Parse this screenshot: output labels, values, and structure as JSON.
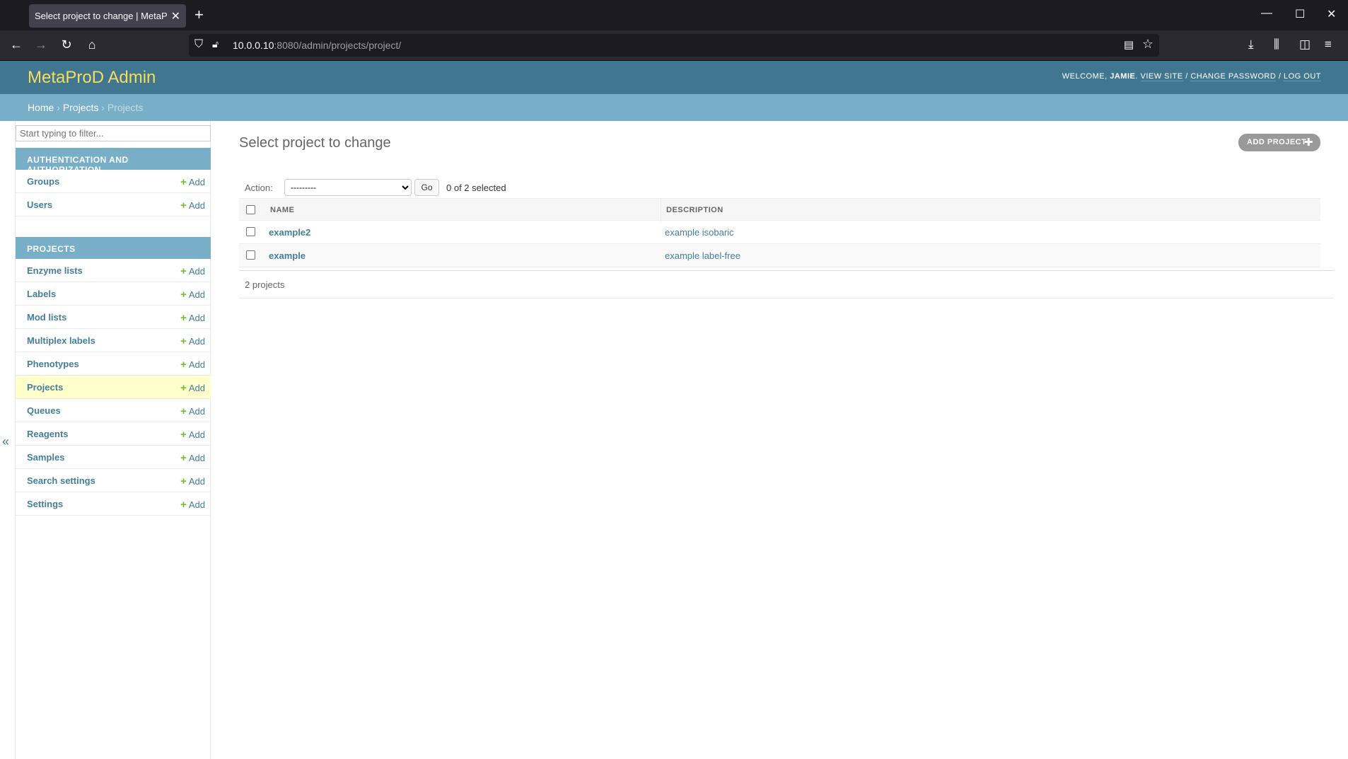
{
  "browser": {
    "tab_title": "Select project to change | MetaProD",
    "url_host": "10.0.0.10",
    "url_rest": ":8080/admin/projects/project/"
  },
  "header": {
    "branding": "MetaProD Admin",
    "welcome": "Welcome,",
    "username": "Jamie",
    "view_site": "View site",
    "change_password": "Change password",
    "log_out": "Log out",
    "sep": "/"
  },
  "breadcrumbs": {
    "home": "Home",
    "app": "Projects",
    "current": "Projects",
    "sep": "›"
  },
  "sidebar": {
    "filter_placeholder": "Start typing to filter...",
    "modules": [
      {
        "caption": "Authentication and Authorization",
        "items": [
          {
            "label": "Groups",
            "add": "Add"
          },
          {
            "label": "Users",
            "add": "Add"
          }
        ]
      },
      {
        "caption": "Projects",
        "items": [
          {
            "label": "Enzyme lists",
            "add": "Add"
          },
          {
            "label": "Labels",
            "add": "Add"
          },
          {
            "label": "Mod lists",
            "add": "Add"
          },
          {
            "label": "Multiplex labels",
            "add": "Add"
          },
          {
            "label": "Phenotypes",
            "add": "Add"
          },
          {
            "label": "Projects",
            "add": "Add"
          },
          {
            "label": "Queues",
            "add": "Add"
          },
          {
            "label": "Reagents",
            "add": "Add"
          },
          {
            "label": "Samples",
            "add": "Add"
          },
          {
            "label": "Search settings",
            "add": "Add"
          },
          {
            "label": "Settings",
            "add": "Add"
          }
        ]
      }
    ]
  },
  "content": {
    "title": "Select project to change",
    "add_button": "Add project",
    "action_label": "Action:",
    "action_selected": "---------",
    "go": "Go",
    "selected_count": "0 of 2 selected",
    "columns": {
      "name": "Name",
      "description": "Description"
    },
    "rows": [
      {
        "name": "example2",
        "description": "example isobaric"
      },
      {
        "name": "example",
        "description": "example label-free"
      }
    ],
    "paginator": "2 projects"
  },
  "colors": {
    "header": "#417690",
    "breadcrumbs": "#79aec8",
    "branding": "#f5dd5d",
    "link": "#447e9b",
    "add_plus": "#70bf2b",
    "current_row": "#ffffcc"
  }
}
